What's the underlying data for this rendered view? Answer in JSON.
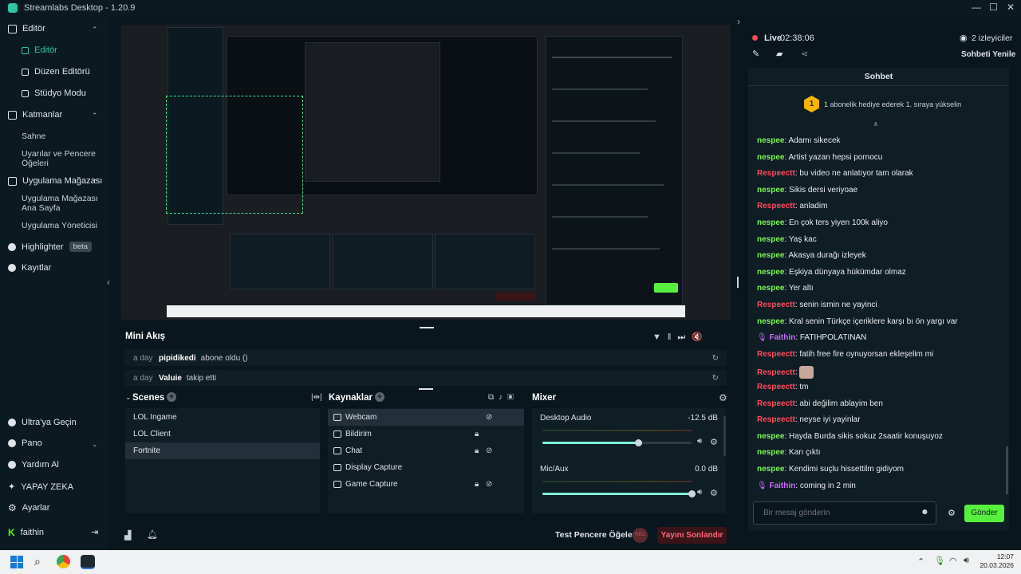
{
  "app": {
    "title": "Streamlabs Desktop - 1.20.9"
  },
  "sidebar": {
    "groups": [
      {
        "label": "Editör",
        "items": [
          "Editör",
          "Düzen Editörü",
          "Stüdyo Modu"
        ]
      },
      {
        "label": "Katmanlar",
        "items": [
          "Sahne",
          "Uyarılar ve Pencere Öğeleri"
        ]
      },
      {
        "label": "Uygulama Mağazası",
        "items": [
          "Uygulama Mağazası Ana Sayfa",
          "Uygulama Yöneticisi"
        ]
      }
    ],
    "highlighter": "Highlighter",
    "beta": "beta",
    "recordings": "Kayıtlar",
    "bottom": [
      "Ultra'ya Geçin",
      "Pano",
      "Yardım Al",
      "YAPAY ZEKA",
      "Ayarlar"
    ],
    "user": "faithin"
  },
  "minifeed": {
    "title": "Mini Akış",
    "rows": [
      {
        "time": "a day",
        "user": "pipidikedi",
        "action": "abone oldu ()"
      },
      {
        "time": "a day",
        "user": "Valuie",
        "action": "takip etti"
      }
    ]
  },
  "scenes": {
    "title": "Scenes",
    "items": [
      "LOL Ingame",
      "LOL Client",
      "Fortnite"
    ],
    "selected": 2
  },
  "sources": {
    "title": "Kaynaklar",
    "items": [
      "Webcam",
      "Bildirim",
      "Chat",
      "Display Capture",
      "Game Capture"
    ],
    "selected": 0
  },
  "mixer": {
    "title": "Mixer",
    "channels": [
      {
        "name": "Desktop Audio",
        "db": "-12.5 dB",
        "level": 0.64
      },
      {
        "name": "Mic/Aux",
        "db": "0.0 dB",
        "level": 1.0
      }
    ]
  },
  "footer": {
    "test_widgets": "Test Pencere Öğeleri",
    "rec": "REC",
    "end_stream": "Yayını Sonlandır"
  },
  "chat": {
    "live_label": "Live",
    "live_time": "02:38:06",
    "viewers": "2 izleyiciler",
    "refresh": "Sohbeti Yenile",
    "title": "Sohbet",
    "gift_rank": "1",
    "gift_text": "1 abonelik hediye ederek 1. sıraya yükselin",
    "messages": [
      {
        "user": "nespee",
        "color": "#7cf55a",
        "text": "Adamı sikecek"
      },
      {
        "user": "nespee",
        "color": "#7cf55a",
        "text": "Artist yazan hepsi pornocu"
      },
      {
        "user": "Respeectt",
        "color": "#ff4b5c",
        "text": "bu video ne anlatıyor tam olarak"
      },
      {
        "user": "nespee",
        "color": "#7cf55a",
        "text": "Sikis dersi veriyoae"
      },
      {
        "user": "Respeectt",
        "color": "#ff4b5c",
        "text": "anladim"
      },
      {
        "user": "nespee",
        "color": "#7cf55a",
        "text": "En çok ters yiyen 100k aliyo"
      },
      {
        "user": "nespee",
        "color": "#7cf55a",
        "text": "Yaş kac"
      },
      {
        "user": "nespee",
        "color": "#7cf55a",
        "text": "Akasya durağı izleyek"
      },
      {
        "user": "nespee",
        "color": "#7cf55a",
        "text": "Eşkiya dünyaya hükümdar olmaz"
      },
      {
        "user": "nespee",
        "color": "#7cf55a",
        "text": "Yer altı"
      },
      {
        "user": "Respeectt",
        "color": "#ff4b5c",
        "text": "senin ismin ne yayinci"
      },
      {
        "user": "nespee",
        "color": "#7cf55a",
        "text": "Kral senin Türkçe içeriklere karşı bı ön yargı var"
      },
      {
        "user": "Faithin",
        "color": "#c76bff",
        "text": "FATIHPOLATINAN",
        "mic": true
      },
      {
        "user": "Respeectt",
        "color": "#ff4b5c",
        "text": "fatih free fire oynuyorsan ekleşelim mi"
      },
      {
        "user": "Respeectt",
        "color": "#ff4b5c",
        "text": "",
        "emote": true
      },
      {
        "user": "Respeectt",
        "color": "#ff4b5c",
        "text": "tm"
      },
      {
        "user": "Respeectt",
        "color": "#ff4b5c",
        "text": "abi değilim ablayim ben"
      },
      {
        "user": "Respeectt",
        "color": "#ff4b5c",
        "text": "neyse iyi yayinlar"
      },
      {
        "user": "nespee",
        "color": "#7cf55a",
        "text": "Hayda Burda sikis sokuz 2saatir konuşuyoz"
      },
      {
        "user": "nespee",
        "color": "#7cf55a",
        "text": "Karı çıktı"
      },
      {
        "user": "nespee",
        "color": "#7cf55a",
        "text": "Kendimi suçlu hissettilm gidiyom"
      },
      {
        "user": "Faithin",
        "color": "#c76bff",
        "text": "coming in 2 min",
        "mic": true
      }
    ],
    "input_placeholder": "Bir mesaj gönderin",
    "send": "Gönder"
  },
  "taskbar": {
    "time": "12:07",
    "date": "20.03.2026"
  },
  "colors": {
    "accent": "#31c3a2",
    "send": "#58f03f",
    "end_stream": "#3a1418"
  }
}
